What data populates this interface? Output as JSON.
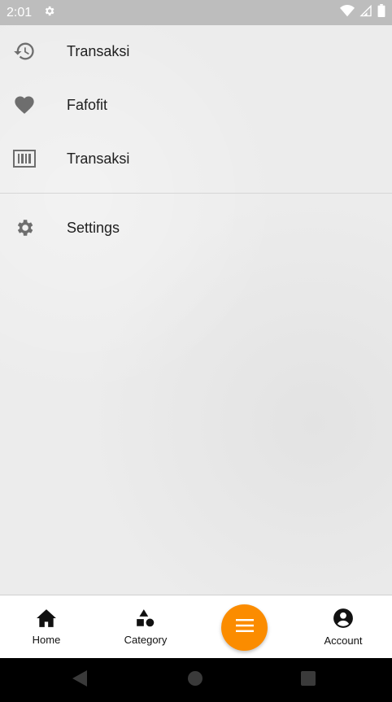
{
  "status_bar": {
    "time": "2:01",
    "icons": [
      "settings-icon",
      "wifi-icon",
      "signal-icon",
      "battery-icon"
    ]
  },
  "drawer": {
    "items": [
      {
        "label": "Transaksi",
        "icon": "history-icon"
      },
      {
        "label": "Fafofit",
        "icon": "heart-icon"
      },
      {
        "label": "Transaksi",
        "icon": "barcode-icon"
      },
      {
        "label": "Settings",
        "icon": "gear-icon"
      }
    ]
  },
  "bottom_nav": {
    "items": [
      {
        "label": "Home",
        "icon": "home-icon"
      },
      {
        "label": "Category",
        "icon": "category-icon"
      },
      {
        "label": "",
        "icon": "menu-icon"
      },
      {
        "label": "Account",
        "icon": "account-icon"
      }
    ]
  },
  "colors": {
    "accent": "#fb8c00",
    "status_bar": "#bdbdbd",
    "drawer_bg": "#ececec",
    "icon": "#6e6e6e"
  }
}
